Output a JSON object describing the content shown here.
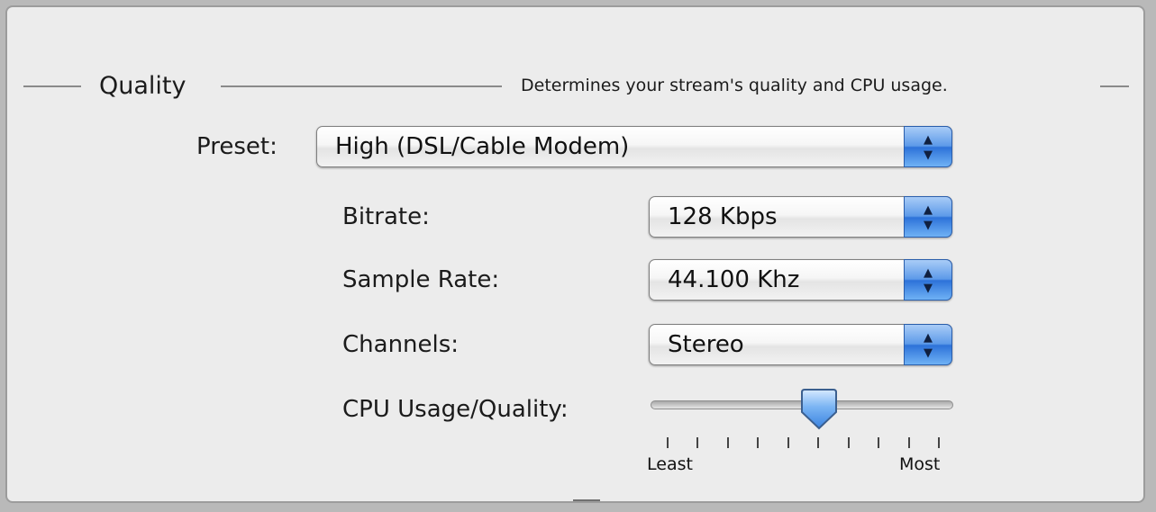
{
  "quality": {
    "title": "Quality",
    "description": "Determines your stream's quality and CPU usage."
  },
  "preset": {
    "label": "Preset:",
    "value": "High (DSL/Cable Modem)"
  },
  "bitrate": {
    "label": "Bitrate:",
    "value": "128 Kbps"
  },
  "sample_rate": {
    "label": "Sample Rate:",
    "value": "44.100 Khz"
  },
  "channels": {
    "label": "Channels:",
    "value": "Stereo"
  },
  "cpu_usage": {
    "label": "CPU Usage/Quality:",
    "min_label": "Least",
    "max_label": "Most",
    "tick_count": 10,
    "value_fraction": 0.56
  },
  "icons": {
    "popup_arrows": "up-down-arrows-icon",
    "slider_knob": "slider-knob-icon"
  },
  "colors": {
    "accent_blue": "#2d72d9"
  }
}
